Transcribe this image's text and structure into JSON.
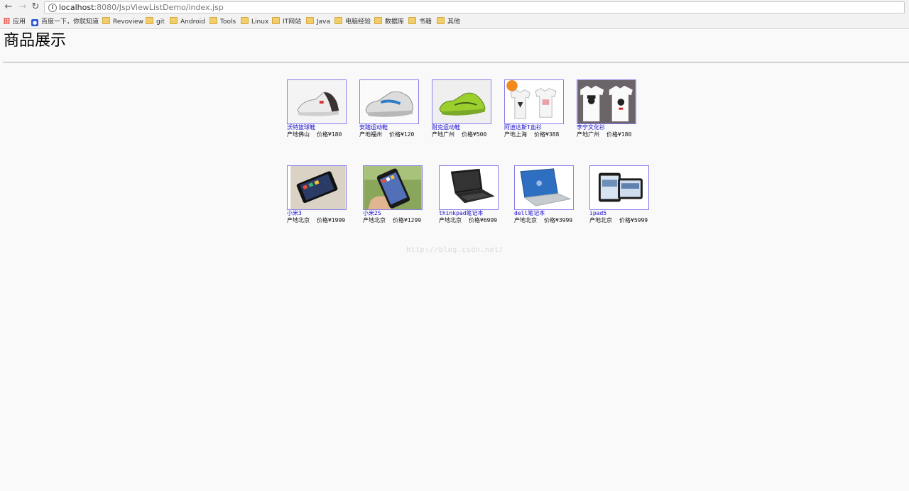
{
  "browser": {
    "url_host": "localhost",
    "url_rest": ":8080/JspViewListDemo/index.jsp",
    "bookmarks": [
      "应用",
      "百度一下，你就知道",
      "Revoview",
      "git",
      "Android",
      "Tools",
      "Linux",
      "IT网站",
      "Java",
      "电脑经验",
      "数据库",
      "书籍",
      "其他"
    ]
  },
  "page": {
    "title": "商品展示",
    "watermark": "http://blog.csdn.net/"
  },
  "products": [
    {
      "name": "沃特篮球鞋",
      "origin": "产地佛山",
      "price": "价格¥180",
      "icon": "sneaker-white-icon"
    },
    {
      "name": "安踏运动鞋",
      "origin": "产地福州",
      "price": "价格¥120",
      "icon": "sneaker-grey-blue-icon"
    },
    {
      "name": "耐克运动鞋",
      "origin": "产地广州",
      "price": "价格¥500",
      "icon": "sneaker-green-icon"
    },
    {
      "name": "阿迪达斯T血衫",
      "origin": "产地上海",
      "price": "价格¥388",
      "icon": "tshirt-pair-icon"
    },
    {
      "name": "李宁文化衫",
      "origin": "产地广州",
      "price": "价格¥180",
      "icon": "tshirt-couple-icon"
    },
    {
      "name": "小米3",
      "origin": "产地北京",
      "price": "价格¥1999",
      "icon": "phone-black-icon"
    },
    {
      "name": "小米2S",
      "origin": "产地北京",
      "price": "价格¥1299",
      "icon": "phone-in-hand-icon"
    },
    {
      "name": "thinkpad笔记本",
      "origin": "产地北京",
      "price": "价格¥6999",
      "icon": "laptop-black-icon"
    },
    {
      "name": "dell笔记本",
      "origin": "产地北京",
      "price": "价格¥3999",
      "icon": "laptop-blue-icon"
    },
    {
      "name": "ipad5",
      "origin": "产地北京",
      "price": "价格¥5999",
      "icon": "tablet-icon"
    }
  ]
}
